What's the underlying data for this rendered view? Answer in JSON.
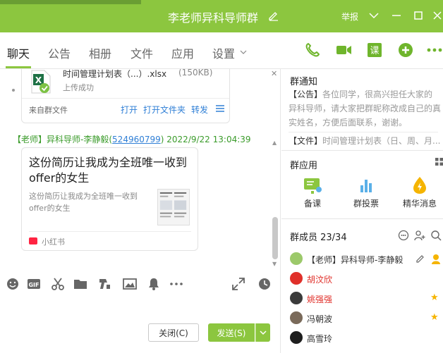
{
  "window": {
    "title": "李老师异科导师群",
    "report_label": "举报"
  },
  "tabs": [
    {
      "label": "聊天"
    },
    {
      "label": "公告"
    },
    {
      "label": "相册"
    },
    {
      "label": "文件"
    },
    {
      "label": "应用"
    },
    {
      "label": "设置"
    }
  ],
  "toolbar_icons": [
    "phone-icon",
    "video-icon",
    "class-icon",
    "add-icon",
    "more-icon"
  ],
  "toolbar_class_label": "课",
  "file_message": {
    "file_name": "时间管理计划表（...）.xlsx",
    "file_size": "(150KB)",
    "status": "上传成功",
    "from": "来自群文件",
    "actions": [
      "打开",
      "打开文件夹",
      "转发"
    ]
  },
  "sender": {
    "tag": "【老师】",
    "name": "异科导师-李静毅",
    "qq_number": "524960799",
    "timestamp": "2022/9/22 13:04:39"
  },
  "share_card": {
    "title": "这份简历让我成为全班唯一收到offer的女生",
    "description": "这份简历让我成为全班唯一收到offer的女生",
    "source": "小红书"
  },
  "input_bar": {
    "icons": [
      "emoji-icon",
      "gif-icon",
      "scissors-icon",
      "folder-icon",
      "font-icon",
      "image-icon",
      "bell-icon",
      "ellipsis-icon",
      "expand-icon",
      "history-icon"
    ],
    "gif_label": "GIF",
    "close_button": "关闭(C)",
    "send_button": "发送(S)"
  },
  "notice": {
    "title": "群通知",
    "label": "【公告】",
    "text": "各位同学，很高兴担任大家的异科导师，请大家把群昵称改成自己的真实姓名，方便后面联系，谢谢。",
    "file_label": "【文件】",
    "file_text": "时间管理计划表（日、周、月..."
  },
  "apps": {
    "title": "群应用",
    "items": [
      {
        "label": "备课",
        "icon": "lesson-prep-icon"
      },
      {
        "label": "群投票",
        "icon": "vote-icon"
      },
      {
        "label": "精华消息",
        "icon": "essence-icon"
      }
    ]
  },
  "members": {
    "title": "群成员 23/34",
    "list": [
      {
        "name": "【老师】异科导师-李静毅",
        "color": "#333333",
        "star": false
      },
      {
        "name": "胡汶欣",
        "color": "#e0302a",
        "star": false
      },
      {
        "name": "姚强强",
        "color": "#e0302a",
        "star": true
      },
      {
        "name": "冯朝波",
        "color": "#333333",
        "star": true
      },
      {
        "name": "高雪玲",
        "color": "#333333",
        "star": false
      }
    ]
  },
  "colors": {
    "brand_green": "#8cc63f",
    "link_blue": "#2f7fd6",
    "name_red": "#e0302a"
  }
}
